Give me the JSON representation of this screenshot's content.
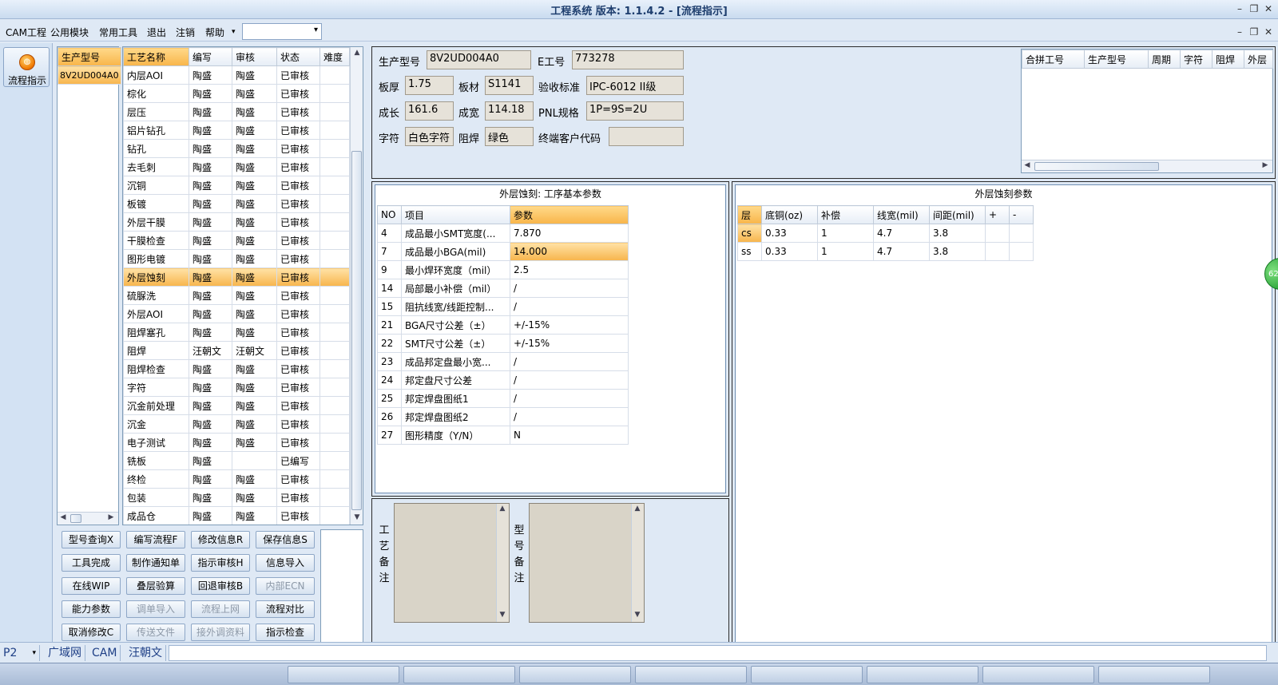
{
  "window": {
    "title": "工程系统  版本: 1.1.4.2 - [流程指示]"
  },
  "menu": {
    "items": [
      "CAM工程",
      "公用模块",
      "常用工具",
      "退出",
      "注销",
      "帮助"
    ]
  },
  "nav": {
    "label": "流程指示"
  },
  "model_list": {
    "header": "生产型号",
    "items": [
      "8V2UD004A0"
    ]
  },
  "process_grid": {
    "columns": [
      "工艺名称",
      "编写",
      "审核",
      "状态",
      "难度"
    ],
    "selected_index": 11,
    "rows": [
      [
        "内层AOI",
        "陶盛",
        "陶盛",
        "已审核",
        ""
      ],
      [
        "棕化",
        "陶盛",
        "陶盛",
        "已审核",
        ""
      ],
      [
        "层压",
        "陶盛",
        "陶盛",
        "已审核",
        ""
      ],
      [
        "铝片钻孔",
        "陶盛",
        "陶盛",
        "已审核",
        ""
      ],
      [
        "钻孔",
        "陶盛",
        "陶盛",
        "已审核",
        ""
      ],
      [
        "去毛刺",
        "陶盛",
        "陶盛",
        "已审核",
        ""
      ],
      [
        "沉铜",
        "陶盛",
        "陶盛",
        "已审核",
        ""
      ],
      [
        "板镀",
        "陶盛",
        "陶盛",
        "已审核",
        ""
      ],
      [
        "外层干膜",
        "陶盛",
        "陶盛",
        "已审核",
        ""
      ],
      [
        "干膜检查",
        "陶盛",
        "陶盛",
        "已审核",
        ""
      ],
      [
        "图形电镀",
        "陶盛",
        "陶盛",
        "已审核",
        ""
      ],
      [
        "外层蚀刻",
        "陶盛",
        "陶盛",
        "已审核",
        ""
      ],
      [
        "硫脲洗",
        "陶盛",
        "陶盛",
        "已审核",
        ""
      ],
      [
        "外层AOI",
        "陶盛",
        "陶盛",
        "已审核",
        ""
      ],
      [
        "阻焊塞孔",
        "陶盛",
        "陶盛",
        "已审核",
        ""
      ],
      [
        "阻焊",
        "汪朝文",
        "汪朝文",
        "已审核",
        ""
      ],
      [
        "阻焊检查",
        "陶盛",
        "陶盛",
        "已审核",
        ""
      ],
      [
        "字符",
        "陶盛",
        "陶盛",
        "已审核",
        ""
      ],
      [
        "沉金前处理",
        "陶盛",
        "陶盛",
        "已审核",
        ""
      ],
      [
        "沉金",
        "陶盛",
        "陶盛",
        "已审核",
        ""
      ],
      [
        "电子测试",
        "陶盛",
        "陶盛",
        "已审核",
        ""
      ],
      [
        "铣板",
        "陶盛",
        "",
        "已编写",
        ""
      ],
      [
        "终检",
        "陶盛",
        "陶盛",
        "已审核",
        ""
      ],
      [
        "包装",
        "陶盛",
        "陶盛",
        "已审核",
        ""
      ],
      [
        "成品仓",
        "陶盛",
        "陶盛",
        "已审核",
        ""
      ]
    ]
  },
  "buttons": [
    [
      "型号查询X",
      "编写流程F",
      "修改信息R",
      "保存信息S"
    ],
    [
      "工具完成",
      "制作通知单",
      "指示审核H",
      "信息导入"
    ],
    [
      "在线WIP",
      "叠层验算",
      "回退审核B",
      "内部ECN"
    ],
    [
      "能力参数",
      "调单导入",
      "流程上网",
      "流程对比"
    ],
    [
      "取消修改C",
      "传送文件",
      "接外调资料",
      "指示检查"
    ]
  ],
  "disabled_buttons": [
    "内部ECN",
    "调单导入",
    "流程上网",
    "传送文件",
    "接外调资料"
  ],
  "info": {
    "prod_model_label": "生产型号",
    "prod_model": "8V2UD004A0",
    "e_no_label": "E工号",
    "e_no": "773278",
    "thickness_label": "板厚",
    "thickness": "1.75",
    "material_label": "板材",
    "material": "S1141",
    "standard_label": "验收标准",
    "standard": "IPC-6012 II级",
    "length_label": "成长",
    "length": "161.6",
    "width_label": "成宽",
    "width": "114.18",
    "pnl_label": "PNL规格",
    "pnl": "1P=9S=2U",
    "char_label": "字符",
    "char": "白色字符",
    "mask_label": "阻焊",
    "mask": "绿色",
    "customer_label": "终端客户代码",
    "customer": ""
  },
  "merge_grid": {
    "columns": [
      "合拼工号",
      "生产型号",
      "周期",
      "字符",
      "阻焊",
      "外层"
    ]
  },
  "basic_params": {
    "title": "外层蚀刻: 工序基本参数",
    "columns": [
      "NO",
      "项目",
      "参数"
    ],
    "rows": [
      [
        "4",
        "成品最小SMT宽度(...",
        "7.870"
      ],
      [
        "7",
        "成品最小BGA(mil)",
        "14.000"
      ],
      [
        "9",
        "最小焊环宽度（mil）",
        "2.5"
      ],
      [
        "14",
        "局部最小补偿（mil）",
        "/"
      ],
      [
        "15",
        "阻抗线宽/线距控制...",
        "/"
      ],
      [
        "21",
        "BGA尺寸公差（±）",
        "+/-15%"
      ],
      [
        "22",
        "SMT尺寸公差（±）",
        "+/-15%"
      ],
      [
        "23",
        "成品邦定盘最小宽...",
        "/"
      ],
      [
        "24",
        "邦定盘尺寸公差",
        "/"
      ],
      [
        "25",
        "邦定焊盘图纸1",
        "/"
      ],
      [
        "26",
        "邦定焊盘图纸2",
        "/"
      ],
      [
        "27",
        "图形精度（Y/N）",
        "N"
      ]
    ]
  },
  "etch_params": {
    "title": "外层蚀刻参数",
    "columns": [
      "层",
      "底铜(oz)",
      "补偿",
      "线宽(mil)",
      "间距(mil)",
      "+",
      "-"
    ],
    "rows": [
      [
        "cs",
        "0.33",
        "1",
        "4.7",
        "3.8",
        "",
        ""
      ],
      [
        "ss",
        "0.33",
        "1",
        "4.7",
        "3.8",
        "",
        ""
      ]
    ]
  },
  "memo": {
    "process_label": "工艺备注",
    "model_label": "型号备注"
  },
  "status": {
    "combo": "P2",
    "tabs": [
      "广域网",
      "CAM",
      "汪朝文"
    ]
  },
  "floating_badge": "62"
}
